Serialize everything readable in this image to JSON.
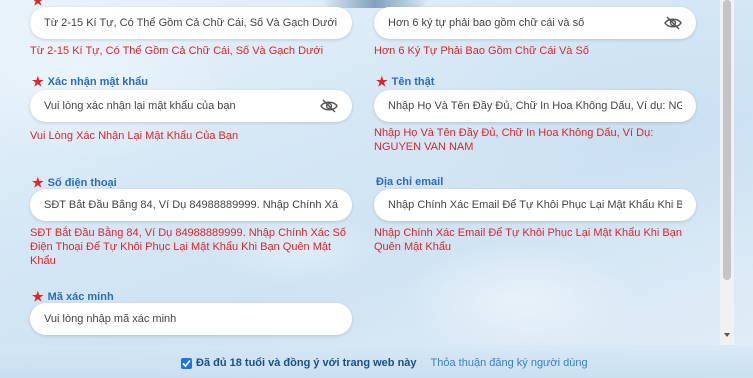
{
  "form": {
    "username_hint": {
      "value": "Từ 2-15 Kí Tự, Có Thể Gồm Cả Chữ Cái, Số Và Gạch Dưới",
      "error": "Từ 2-15 Kí Tự, Có Thể Gồm Cả Chữ Cái, Số Và Gạch Dưới"
    },
    "password": {
      "value": "Hơn 6 ký tự phải bao gồm chữ cái và số",
      "error": "Hơn 6 Ký Tự Phải Bao Gồm Chữ Cái Và Số"
    },
    "confirm_password": {
      "label": "Xác nhận mật khẩu",
      "placeholder": "Vui lòng xác nhận lại mật khẩu của bạn",
      "error": "Vui Lòng Xác Nhận Lại Mật Khẩu Của Bạn"
    },
    "real_name": {
      "label": "Tên thật",
      "placeholder": "Nhập Họ Và Tên Đầy Đủ, Chữ In Hoa Không Dấu, Ví dụ: NG",
      "error_line1": "Nhập Họ Và Tên Đầy Đủ, Chữ In Hoa Không Dấu, Ví Dụ:",
      "error_line2": "NGUYEN VAN NAM"
    },
    "phone": {
      "label": "Số điện thoại",
      "placeholder": "SĐT Bắt Đầu Bằng 84, Ví Dụ 84988889999. Nhập Chính Xác",
      "error_line1": "SĐT Bắt Đầu Bằng 84, Ví Dụ 84988889999. Nhập Chính Xác Số",
      "error_line2": "Điện Thoại Để Tự Khôi Phục Lại Mật Khẩu Khi Bạn Quên Mật",
      "error_line3": "Khẩu"
    },
    "email": {
      "label": "Địa chỉ email",
      "placeholder": "Nhập Chính Xác Email Để Tự Khôi Phục Lại Mật Khẩu Khi Bạ",
      "error_line1": "Nhập Chính Xác Email Để Tự Khôi Phục Lại Mật Khẩu Khi Bạn",
      "error_line2": "Quên Mật Khẩu"
    },
    "captcha": {
      "label": "Mã xác minh",
      "placeholder": "Vui lòng nhập mã xác minh"
    }
  },
  "agreement": {
    "text": "Đã đủ 18 tuổi và đồng ý với trang web này",
    "link": "Thỏa thuận đăng ký người dùng",
    "checked": true
  },
  "colors": {
    "label": "#2b6cb8",
    "error": "#e0242a",
    "checkbox": "#1a73e8"
  }
}
